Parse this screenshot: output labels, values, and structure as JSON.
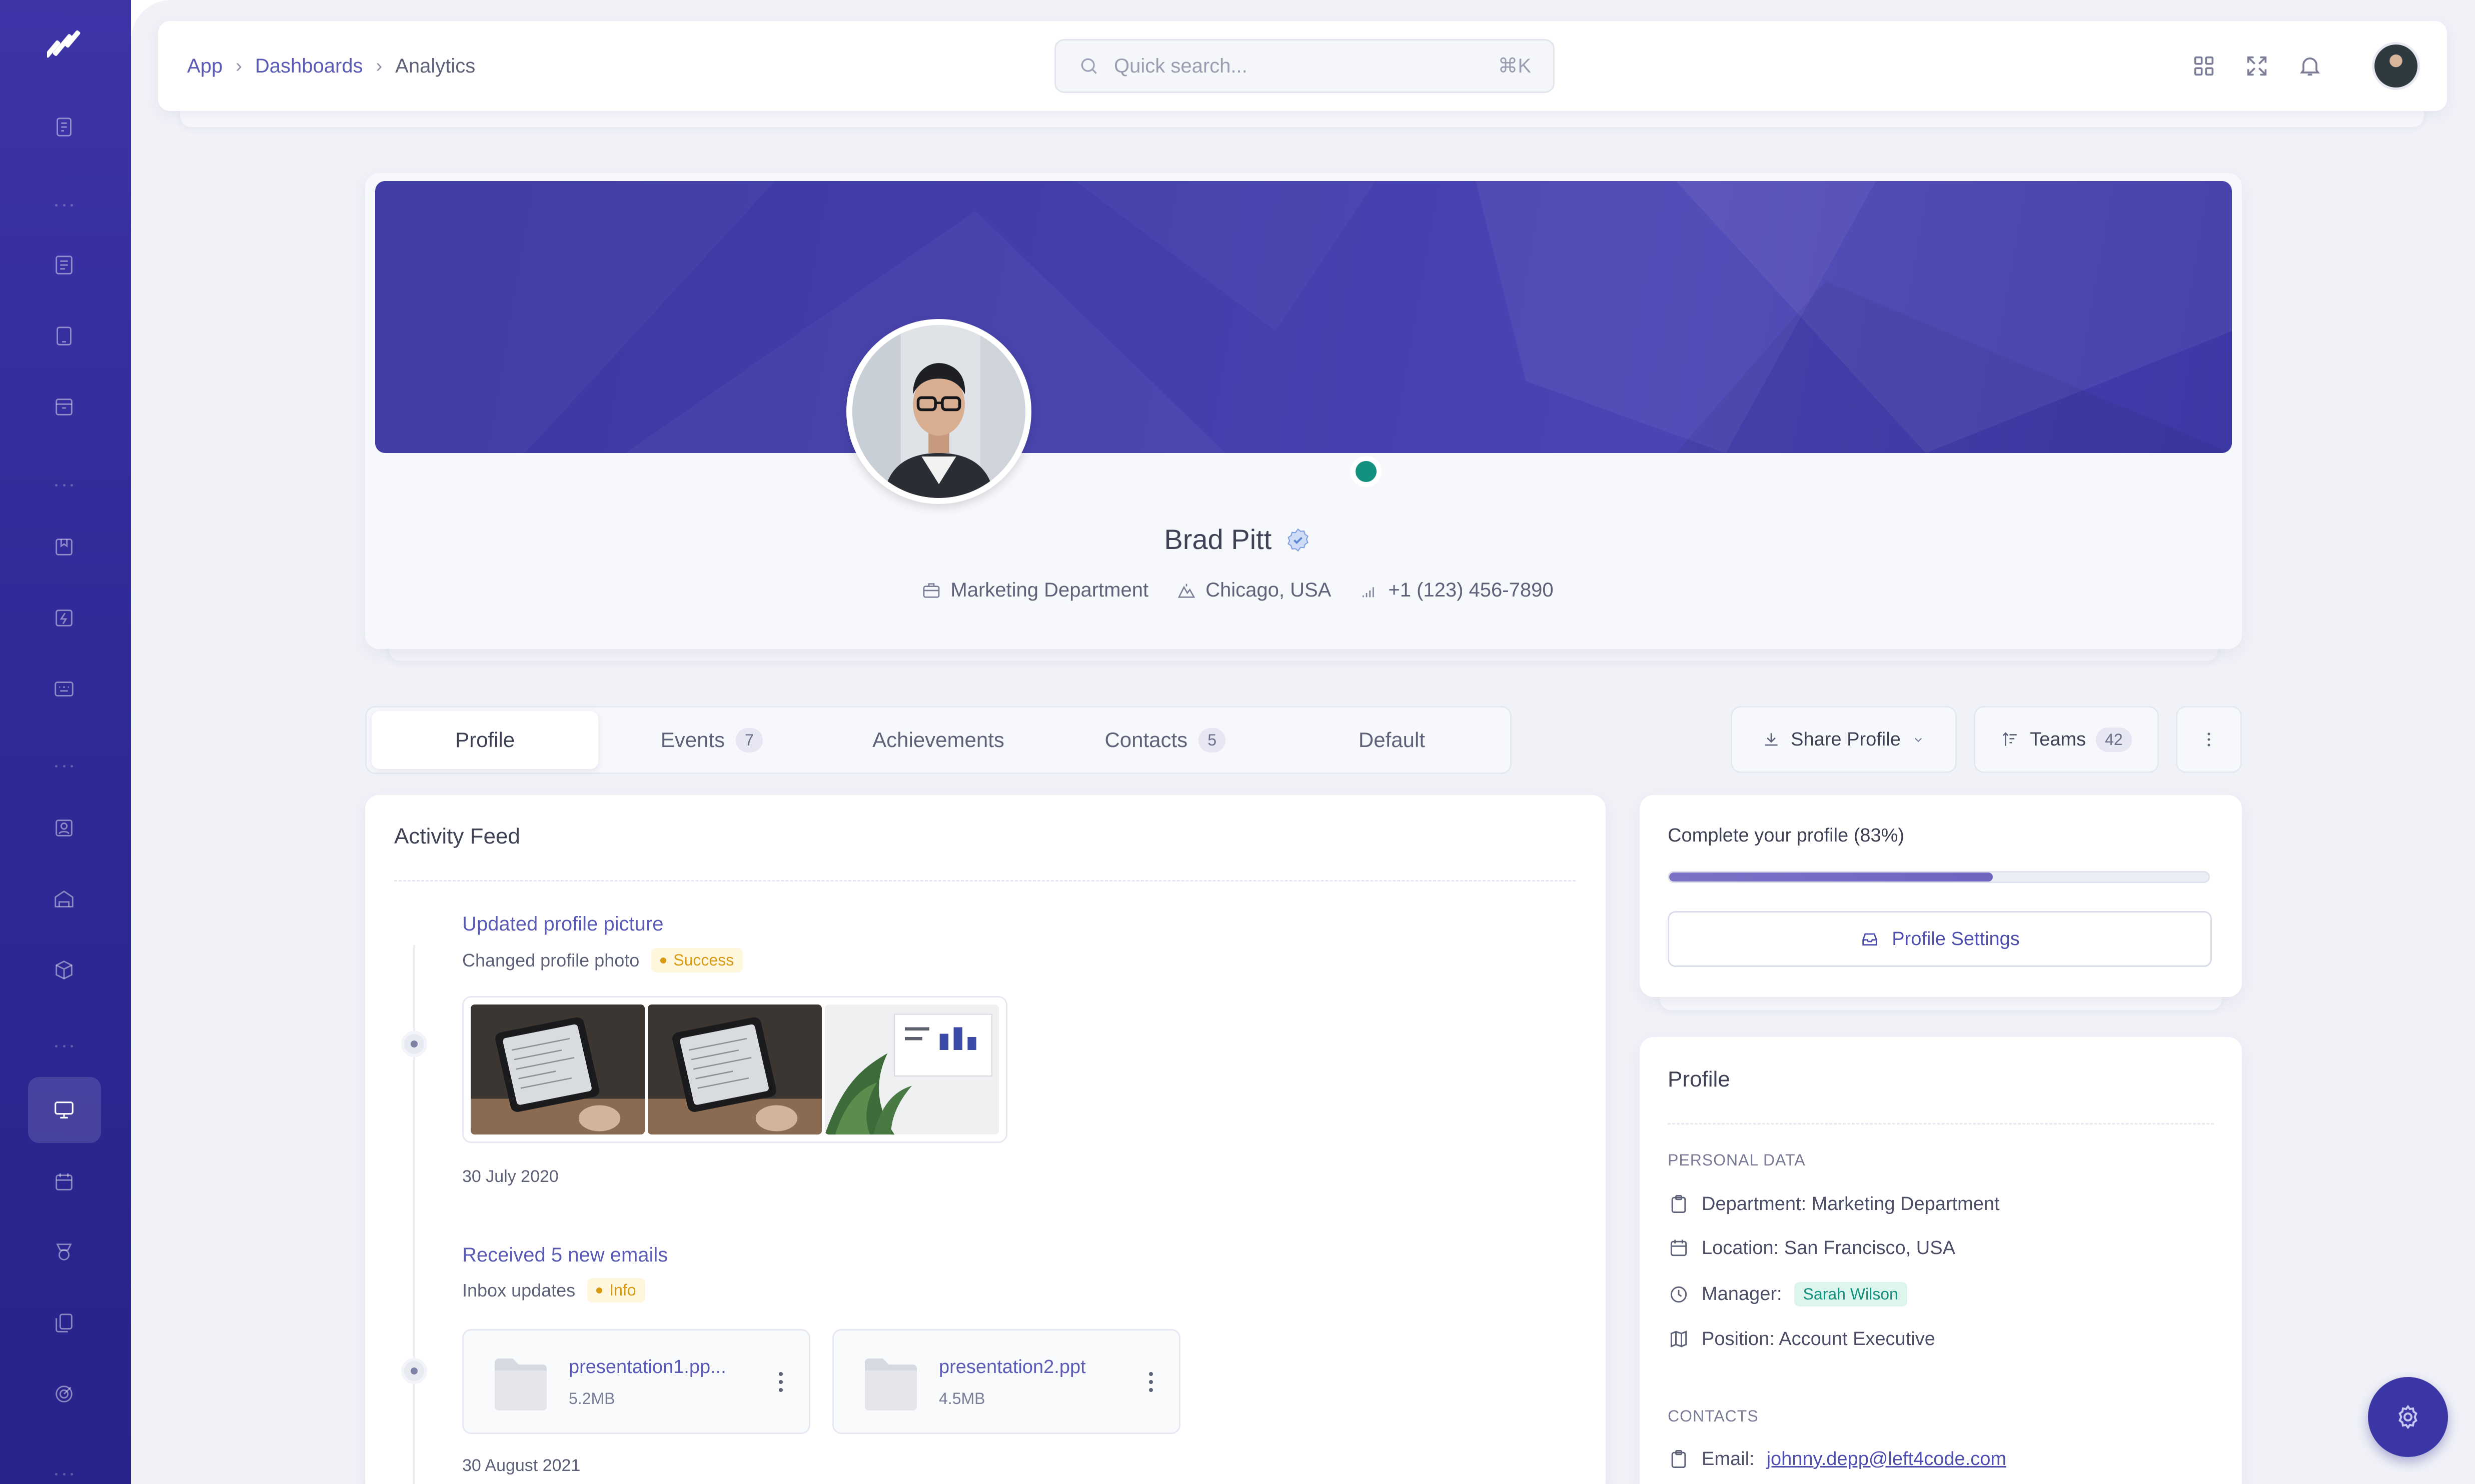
{
  "colors": {
    "sidebar": "#2f2a98",
    "accent": "#5a5bb5",
    "cover": "#443fad",
    "online": "#13907e",
    "warning_badge": "#d79a11",
    "info_badge": "#d79a11",
    "manager_badge": "#15927f"
  },
  "sidebar": {
    "icons": [
      "logo-icon",
      "reports-icon",
      "document-icon",
      "tablet-icon",
      "archive-icon",
      "bookmark-icon",
      "lightning-icon",
      "keyboard-icon",
      "user-card-icon",
      "building-icon",
      "package-icon",
      "presentation-icon",
      "calendar-icon",
      "award-icon",
      "files-icon",
      "target-icon"
    ],
    "active": "presentation-icon"
  },
  "topbar": {
    "breadcrumb": [
      "App",
      "Dashboards",
      "Analytics"
    ],
    "search_placeholder": "Quick search...",
    "search_shortcut": "⌘K",
    "icons": [
      "apps-grid-icon",
      "fullscreen-icon",
      "notification-bell-icon",
      "user-avatar"
    ]
  },
  "profile": {
    "name": "Brad Pitt",
    "verified": true,
    "online": true,
    "department": "Marketing Department",
    "location": "Chicago, USA",
    "phone": "+1 (123) 456-7890"
  },
  "tabs": [
    {
      "label": "Profile",
      "count": null,
      "active": true
    },
    {
      "label": "Events",
      "count": "7",
      "active": false
    },
    {
      "label": "Achievements",
      "count": null,
      "active": false
    },
    {
      "label": "Contacts",
      "count": "5",
      "active": false
    },
    {
      "label": "Default",
      "count": null,
      "active": false
    }
  ],
  "actions": {
    "share_label": "Share Profile",
    "teams_label": "Teams",
    "teams_count": "42"
  },
  "feed": {
    "title": "Activity Feed",
    "events": [
      {
        "title": "Updated profile picture",
        "subtitle": "Changed profile photo",
        "badge": "Success",
        "date": "30 July 2020"
      },
      {
        "title": "Received 5 new emails",
        "subtitle": "Inbox updates",
        "badge": "Info",
        "date": "30 August 2021",
        "files": [
          {
            "name": "presentation1.pp...",
            "size": "5.2MB"
          },
          {
            "name": "presentation2.ppt",
            "size": "4.5MB"
          }
        ]
      }
    ]
  },
  "completion": {
    "title": "Complete your profile (83%)",
    "percent": 0.6,
    "button_label": "Profile Settings"
  },
  "profile_card": {
    "title": "Profile",
    "personal_section": "PERSONAL DATA",
    "department_label": "Department:",
    "department_value": "Marketing Department",
    "location_label": "Location:",
    "location_value": "San Francisco, USA",
    "manager_label": "Manager:",
    "manager_value": "Sarah Wilson",
    "position_label": "Position:",
    "position_value": "Account Executive",
    "contacts_section": "CONTACTS",
    "email_label": "Email:",
    "email_value": "johnny.depp@left4code.com"
  }
}
